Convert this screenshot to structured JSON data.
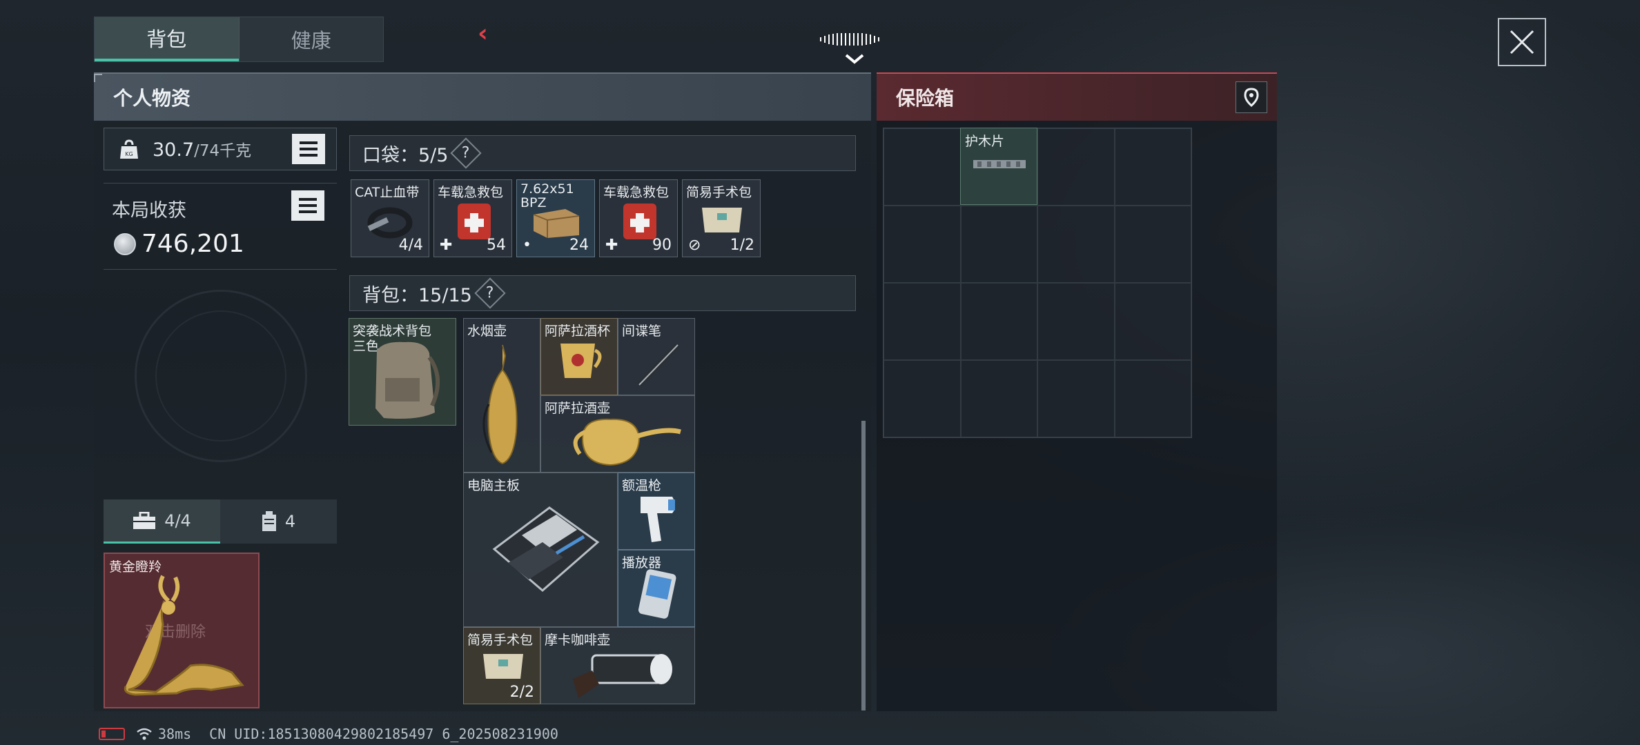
{
  "top_tabs": {
    "backpack": "背包",
    "health": "健康"
  },
  "personal": {
    "title": "个人物资",
    "weight_current": "30.7",
    "weight_max": "/74千克",
    "harvest_label": "本局收获",
    "harvest_value": "746,201",
    "sub_tabs": {
      "tools_count": "4/4",
      "keys_count": "4"
    },
    "gold_card": {
      "name": "黄金瞪羚",
      "watermark": "双击删除"
    }
  },
  "pockets": {
    "label": "口袋：5/5",
    "help": "?",
    "items": [
      {
        "name": "CAT止血带",
        "count": "4/4"
      },
      {
        "name": "车载急救包",
        "count": "54"
      },
      {
        "name": "7.62x51 BPZ",
        "count": "24"
      },
      {
        "name": "车载急救包",
        "count": "90"
      },
      {
        "name": "简易手术包",
        "count": "1/2"
      }
    ]
  },
  "backpack": {
    "label": "背包：15/15",
    "help": "?",
    "gear_name": "突袭战术背包",
    "gear_sub": "三色",
    "items": [
      {
        "name": "水烟壶"
      },
      {
        "name": "阿萨拉酒杯"
      },
      {
        "name": "间谍笔"
      },
      {
        "name": "阿萨拉酒壶"
      },
      {
        "name": "电脑主板"
      },
      {
        "name": "额温枪"
      },
      {
        "name": "播放器"
      },
      {
        "name": "简易手术包",
        "count": "2/2"
      },
      {
        "name": "摩卡咖啡壶"
      }
    ]
  },
  "safe": {
    "title": "保险箱",
    "items": [
      {
        "name": "护木片"
      }
    ]
  },
  "status": {
    "ping": "38ms",
    "uid": "CN UID:18513080429802185497 6_202508231900"
  },
  "colors": {
    "accent": "#49c2a8",
    "danger": "#c84a55"
  }
}
